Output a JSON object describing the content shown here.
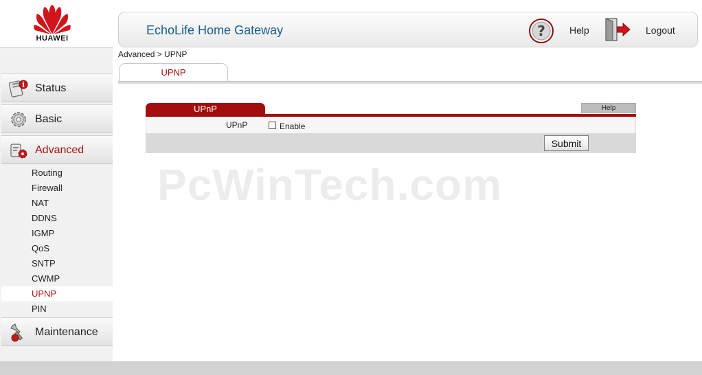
{
  "brand": {
    "name": "HUAWEI"
  },
  "header": {
    "title": "EchoLife Home Gateway",
    "help_label": "Help",
    "logout_label": "Logout"
  },
  "breadcrumb": "Advanced > UPNP",
  "page_tab": "UPNP",
  "sidebar": {
    "status": "Status",
    "basic": "Basic",
    "advanced": "Advanced",
    "maintenance": "Maintenance",
    "submenu": [
      "Routing",
      "Firewall",
      "NAT",
      "DDNS",
      "IGMP",
      "QoS",
      "SNTP",
      "CWMP",
      "UPNP",
      "PIN"
    ],
    "active_submenu": "UPNP"
  },
  "panel": {
    "title": "UPnP",
    "help_label": "Help",
    "field_label": "UPnP",
    "checkbox_label": "Enable",
    "checkbox_checked": false,
    "submit_label": "Submit"
  },
  "watermark": "PcWinTech.com",
  "colors": {
    "accent_red": "#a30d0d",
    "title_blue": "#165b91"
  },
  "icons": {
    "status": "status-icon",
    "basic": "gear-icon",
    "advanced": "advanced-icon",
    "maintenance": "maintenance-icon",
    "help": "help-icon",
    "logout": "logout-icon"
  }
}
